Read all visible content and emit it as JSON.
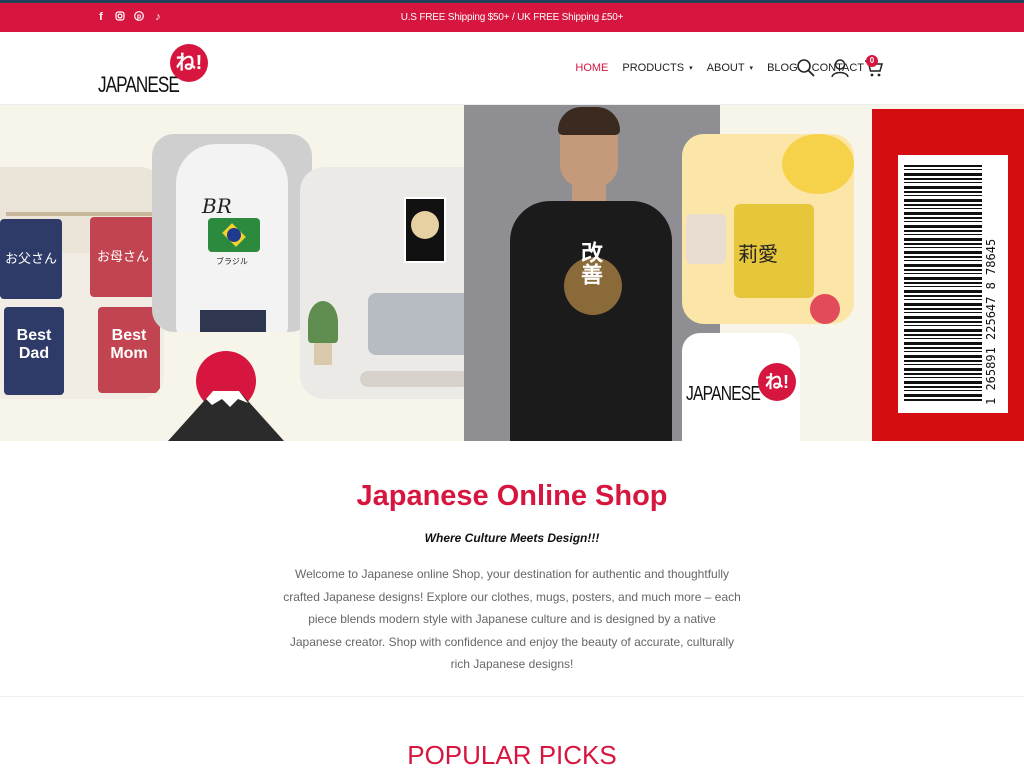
{
  "topbar": {
    "shipping": "U.S FREE Shipping $50+ / UK FREE Shipping £50+",
    "social_icons": [
      "facebook-icon",
      "instagram-icon",
      "pinterest-icon",
      "tiktok-icon"
    ]
  },
  "logo": {
    "text": "JAPANESE",
    "mark": "ね!"
  },
  "nav": {
    "items": [
      {
        "label": "HOME",
        "active": true
      },
      {
        "label": "PRODUCTS",
        "dropdown": true
      },
      {
        "label": "ABOUT",
        "dropdown": true
      },
      {
        "label": "BLOG"
      },
      {
        "label": "CONTACT"
      }
    ],
    "caret": "▾",
    "cart_count": "0"
  },
  "hero": {
    "mugs": [
      "お父さん",
      "お母さん",
      "Best Dad",
      "Best Mom"
    ],
    "hoodie_text": "ブラジル",
    "tshirt_text": "改善",
    "mug_yellow_text": "莉愛",
    "barcode_number": "1 265891 225647 8 78645",
    "logo_text": "JAPANESE",
    "logo_mark": "ね!"
  },
  "main": {
    "title": "Japanese Online Shop",
    "tagline": "Where Culture Meets Design!!!",
    "description": "Welcome to Japanese online Shop, your destination for authentic and thoughtfully crafted Japanese designs! Explore our clothes, mugs, posters, and much more – each piece blends modern style with Japanese culture and is designed by a native Japanese creator. Shop with confidence and enjoy the beauty of accurate, culturally rich Japanese designs!"
  },
  "popular": {
    "heading": "POPULAR PICKS"
  },
  "colors": {
    "accent": "#d7163f",
    "topstrip": "#23415a"
  }
}
